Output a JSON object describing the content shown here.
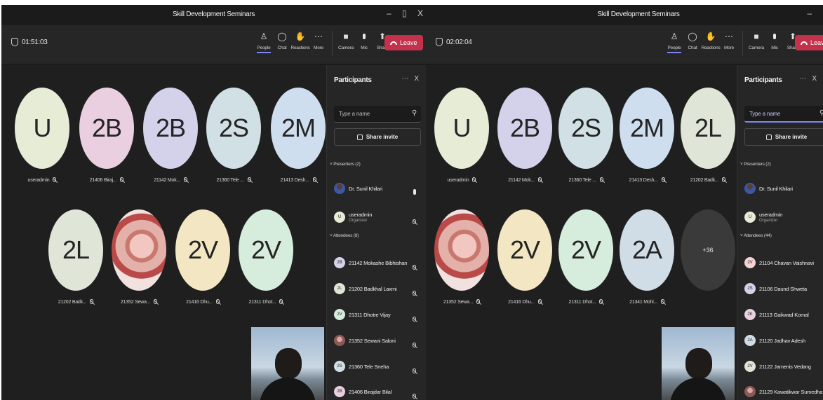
{
  "app_title": "Skill Development Seminars",
  "toolbar": {
    "people": "People",
    "chat": "Chat",
    "reactions": "Reactions",
    "more": "More",
    "camera": "Camera",
    "mic": "Mic",
    "share": "Share",
    "leave": "Leave"
  },
  "left": {
    "timer": "01:51:03",
    "tiles": [
      {
        "initials": "U",
        "name": "useradmin",
        "color": "#e6ecd6"
      },
      {
        "initials": "2B",
        "name": "21406 Biraj...",
        "color": "#e9cfe0"
      },
      {
        "initials": "2B",
        "name": "21142 Mok...",
        "color": "#d3d2ea"
      },
      {
        "initials": "2S",
        "name": "21360 Tele ...",
        "color": "#d1e0e4"
      },
      {
        "initials": "2M",
        "name": "21413 Desh...",
        "color": "#cfdeef"
      },
      {
        "initials": "2L",
        "name": "21202 Badk...",
        "color": "#dfe6d8"
      },
      {
        "initials": "",
        "name": "21352 Sewa...",
        "color": "photo"
      },
      {
        "initials": "2V",
        "name": "21416 Dhu...",
        "color": "#f3e6c3"
      },
      {
        "initials": "2V",
        "name": "21311 Dhot...",
        "color": "#d6ecdd"
      }
    ],
    "panel": {
      "title": "Participants",
      "search_placeholder": "Type a name",
      "share_invite": "Share invite",
      "presenters_label": "Presenters (2)",
      "attendees_label": "Attendees (8)",
      "presenters": [
        {
          "name": "Dr. Sunil Khilari",
          "role": "",
          "avatar": "dr",
          "initials": ""
        },
        {
          "name": "useradmin",
          "role": "Organizer",
          "avatar": "#e6ecd6",
          "initials": "U"
        }
      ],
      "attendees": [
        {
          "name": "21142 Mokashe Bibhishan",
          "avatar": "#d3d2ea",
          "initials": "2B"
        },
        {
          "name": "21202 Badkhal Laxmi",
          "avatar": "#dfe6d8",
          "initials": "2L"
        },
        {
          "name": "21311 Dhotre Vijay",
          "avatar": "#d6ecdd",
          "initials": "2V"
        },
        {
          "name": "21352 Sewani Saloni",
          "avatar": "photo",
          "initials": ""
        },
        {
          "name": "21360 Tele Sneha",
          "avatar": "#d1e0e4",
          "initials": "2S"
        },
        {
          "name": "21406 Birajdar Bilal",
          "avatar": "#e9cfe0",
          "initials": "2B"
        }
      ]
    }
  },
  "right": {
    "timer": "02:02:04",
    "tiles": [
      {
        "initials": "U",
        "name": "useradmin",
        "color": "#e6ecd6"
      },
      {
        "initials": "2B",
        "name": "21142 Mok...",
        "color": "#d3d2ea"
      },
      {
        "initials": "2S",
        "name": "21360 Tele ...",
        "color": "#d1e0e4"
      },
      {
        "initials": "2M",
        "name": "21413 Desh...",
        "color": "#cfdeef"
      },
      {
        "initials": "2L",
        "name": "21202 Badk...",
        "color": "#dfe6d8"
      },
      {
        "initials": "",
        "name": "21352 Sewa...",
        "color": "photo"
      },
      {
        "initials": "2V",
        "name": "21416 Dhu...",
        "color": "#f3e6c3"
      },
      {
        "initials": "2V",
        "name": "21311 Dhot...",
        "color": "#d6ecdd"
      },
      {
        "initials": "2A",
        "name": "21341 Mohi...",
        "color": "#d1dde6"
      },
      {
        "initials": "+36",
        "name": "",
        "color": "more"
      }
    ],
    "panel": {
      "title": "Participants",
      "search_placeholder": "Type a name",
      "share_invite": "Share invite",
      "presenters_label": "Presenters (2)",
      "attendees_label": "Attendees (44)",
      "presenters": [
        {
          "name": "Dr. Sunil Khilari",
          "role": "",
          "avatar": "dr",
          "initials": ""
        },
        {
          "name": "useradmin",
          "role": "Organizer",
          "avatar": "#e6ecd6",
          "initials": "U"
        }
      ],
      "attendees": [
        {
          "name": "21104 Chavan Vaishnavi",
          "avatar": "#f3d3d3",
          "initials": "2V"
        },
        {
          "name": "21106 Daund Shweta",
          "avatar": "#d3d2ea",
          "initials": "2S"
        },
        {
          "name": "21113 Gaikwad Komal",
          "avatar": "#e9cfe0",
          "initials": "2K"
        },
        {
          "name": "21120 Jadhav Adesh",
          "avatar": "#d1dde6",
          "initials": "2A"
        },
        {
          "name": "21122 Jamenis Vedang",
          "avatar": "#dfe6d8",
          "initials": "2V"
        },
        {
          "name": "21129 Kawatikwar Sumedha",
          "avatar": "photo",
          "initials": ""
        }
      ]
    }
  }
}
